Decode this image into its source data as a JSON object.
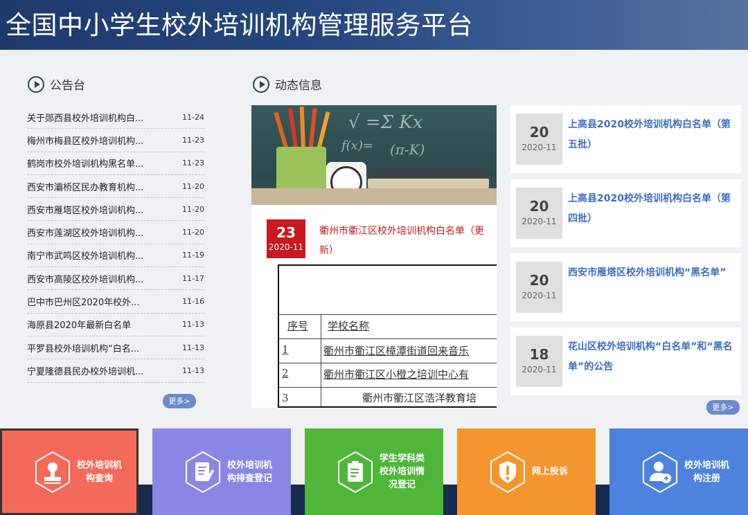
{
  "header": {
    "title": "全国中小学生校外培训机构管理服务平台"
  },
  "notice": {
    "heading": "公告台",
    "more": "更多>",
    "items": [
      {
        "title": "关于郧西县校外培训机构白...",
        "date": "11-24"
      },
      {
        "title": "梅州市梅县区校外培训机构...",
        "date": "11-23"
      },
      {
        "title": "鹤岗市校外培训机构黑名单...",
        "date": "11-23"
      },
      {
        "title": "西安市灞桥区民办教育机构...",
        "date": "11-20"
      },
      {
        "title": "西安市雁塔区校外培训机构...",
        "date": "11-20"
      },
      {
        "title": "西安市莲湖区校外培训机构...",
        "date": "11-20"
      },
      {
        "title": "南宁市武鸣区校外培训机构...",
        "date": "11-19"
      },
      {
        "title": "西安市高陵区校外培训机构...",
        "date": "11-17"
      },
      {
        "title": "巴中市巴州区2020年校外...",
        "date": "11-16"
      },
      {
        "title": "海原县2020年最新白名单",
        "date": "11-13"
      },
      {
        "title": "平罗县校外培训机构“白名...",
        "date": "11-13"
      },
      {
        "title": "宁夏隆德县民办校外培训机...",
        "date": "11-13"
      }
    ]
  },
  "dynamic": {
    "heading": "动态信息",
    "more": "更多>",
    "featured": {
      "day": "23",
      "month": "2020-11",
      "title": "衢州市衢江区校外培训机构白名单（更新）",
      "doc": {
        "col1": "序号",
        "col2": "学校名称",
        "rows": [
          {
            "no": "1",
            "name": "衢州市衢江区樟潭街道回来音乐"
          },
          {
            "no": "2",
            "name": "衢州市衢江区小橙之培训中心有"
          },
          {
            "no": "3",
            "name": "衢州市衢江区浩洋教育培"
          }
        ]
      }
    },
    "news": [
      {
        "day": "20",
        "month": "2020-11",
        "title": "上高县2020校外培训机构白名单（第五批）"
      },
      {
        "day": "20",
        "month": "2020-11",
        "title": "上高县2020校外培训机构白名单（第四批）"
      },
      {
        "day": "20",
        "month": "2020-11",
        "title": "西安市雁塔区校外培训机构“黑名单”"
      },
      {
        "day": "18",
        "month": "2020-11",
        "title": "花山区校外培训机构“白名单”和“黑名单”的公告"
      }
    ]
  },
  "tiles": [
    {
      "label": "校外培训机\n构查询",
      "color": "#f46a5a",
      "icon": "stamp-icon"
    },
    {
      "label": "校外培训机\n构排查登记",
      "color": "#8a86e6",
      "icon": "edit-document-icon"
    },
    {
      "label": "学生学科类\n校外培训情\n况登记",
      "color": "#4fb63a",
      "icon": "clipboard-icon"
    },
    {
      "label": "网上投诉",
      "color": "#f4952e",
      "icon": "shield-alert-icon"
    },
    {
      "label": "校外培训机\n构注册",
      "color": "#4d82df",
      "icon": "user-add-icon"
    }
  ]
}
